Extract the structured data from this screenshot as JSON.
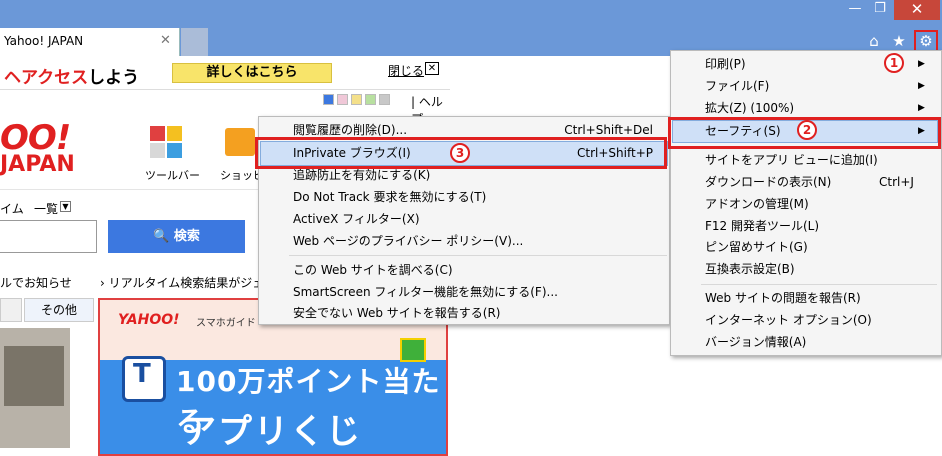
{
  "browser": {
    "tab_title": "Yahoo! JAPAN",
    "tab_close": "✕",
    "minimize": "—",
    "maximize": "❐",
    "close": "✕",
    "icons": {
      "home": "home-icon",
      "favorites": "star-icon",
      "tools": "gear-icon"
    }
  },
  "page": {
    "banner_prefix": "ヘアクセス",
    "banner_suffix": "しよう",
    "banner_button": "詳しくはこちら",
    "close_link": "閉じる",
    "close_x": "✕",
    "help_link": "| ヘルプ",
    "logo_top": "OO!",
    "logo_bottom": "JAPAN",
    "toolbar_label": "ツールバー",
    "shopping_label": "ショッピ",
    "realtime_tab": "イム",
    "ichiran": "一覧",
    "search_button": "🔍 検索",
    "notice": "ルでお知らせ",
    "realtime_link": "› リアルタイム検索結果がジェッ",
    "other_tab": "その他",
    "ad_brand": "YAHOO!",
    "ad_guide": "スマホガイド",
    "ad_line1": "100万ポイント当たる",
    "ad_line2": "アプリくじ",
    "tpoint": "T",
    "swatch_colors": [
      "#3c78e0",
      "#f0c8d8",
      "#f4e08a",
      "#b8e0a0",
      "#c8c8c8"
    ]
  },
  "safety_menu": {
    "items": [
      {
        "label": "閲覧履歴の削除(D)...",
        "shortcut": "Ctrl+Shift+Del"
      },
      {
        "label": "InPrivate ブラウズ(I)",
        "shortcut": "Ctrl+Shift+P"
      },
      {
        "label": "追跡防止を有効にする(K)",
        "shortcut": ""
      },
      {
        "label": "Do Not Track 要求を無効にする(T)",
        "shortcut": ""
      },
      {
        "label": "ActiveX フィルター(X)",
        "shortcut": ""
      },
      {
        "label": "Web ページのプライバシー ポリシー(V)...",
        "shortcut": ""
      },
      {
        "label": "この Web サイトを調べる(C)",
        "shortcut": ""
      },
      {
        "label": "SmartScreen フィルター機能を無効にする(F)...",
        "shortcut": ""
      },
      {
        "label": "安全でない Web サイトを報告する(R)",
        "shortcut": ""
      }
    ]
  },
  "tools_menu": {
    "items": [
      {
        "label": "印刷(P)",
        "shortcut": "",
        "arrow": "▶"
      },
      {
        "label": "ファイル(F)",
        "shortcut": "",
        "arrow": "▶"
      },
      {
        "label": "拡大(Z) (100%)",
        "shortcut": "",
        "arrow": "▶"
      },
      {
        "label": "セーフティ(S)",
        "shortcut": "",
        "arrow": "▶"
      },
      {
        "label": "サイトをアプリ ビューに追加(I)",
        "shortcut": "",
        "arrow": ""
      },
      {
        "label": "ダウンロードの表示(N)",
        "shortcut": "Ctrl+J",
        "arrow": ""
      },
      {
        "label": "アドオンの管理(M)",
        "shortcut": "",
        "arrow": ""
      },
      {
        "label": "F12 開発者ツール(L)",
        "shortcut": "",
        "arrow": ""
      },
      {
        "label": "ピン留めサイト(G)",
        "shortcut": "",
        "arrow": ""
      },
      {
        "label": "互換表示設定(B)",
        "shortcut": "",
        "arrow": ""
      },
      {
        "label": "Web サイトの問題を報告(R)",
        "shortcut": "",
        "arrow": ""
      },
      {
        "label": "インターネット オプション(O)",
        "shortcut": "",
        "arrow": ""
      },
      {
        "label": "バージョン情報(A)",
        "shortcut": "",
        "arrow": ""
      }
    ]
  },
  "annotations": {
    "step1": "1",
    "step2": "2",
    "step3": "3"
  }
}
